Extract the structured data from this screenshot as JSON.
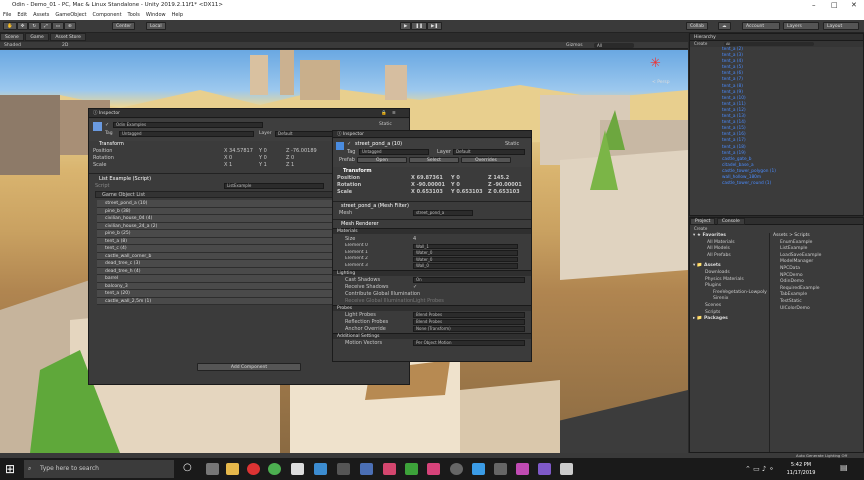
{
  "window": {
    "title": "Odin - Demo_01 - PC, Mac & Linux Standalone - Unity 2019.2.11f1* <DX11>",
    "min_icon": "minimize-icon",
    "max_icon": "maximize-icon",
    "close_icon": "close-icon"
  },
  "menu": [
    "File",
    "Edit",
    "Assets",
    "GameObject",
    "Component",
    "Tools",
    "Window",
    "Help"
  ],
  "toolbar": {
    "pivot": "Center",
    "space": "Local",
    "collab": "Collab",
    "account": "Account",
    "layers": "Layers",
    "layout": "Layout"
  },
  "scene": {
    "tabs": [
      "Scene",
      "Game",
      "Asset Store"
    ],
    "shading": "Shaded",
    "mode": "2D",
    "gizmos": "Gizmos",
    "search": "All",
    "persp": "< Persp"
  },
  "inspector1": {
    "title": "Inspector",
    "active": "✓",
    "name": "Odin Examples",
    "static": "Static",
    "tag_label": "Tag",
    "tag": "Untagged",
    "layer_label": "Layer",
    "layer": "Default",
    "transform": "Transform",
    "pos_label": "Position",
    "pos_x": "X  34.57817",
    "pos_y": "Y  0",
    "pos_z": "Z  -76.00189",
    "rot_label": "Rotation",
    "rot_x": "X  0",
    "rot_y": "Y  0",
    "rot_z": "Z  0",
    "scale_label": "Scale",
    "sc_x": "X  1",
    "sc_y": "Y  1",
    "sc_z": "Z  1",
    "component": "List Example (Script)",
    "script_label": "Script",
    "script": "ListExample",
    "list_label": "Game Object List",
    "items": [
      "street_pond_a (10)",
      "pine_b (38)",
      "civilian_house_04 (4)",
      "civilian_house_24_a (2)",
      "pine_b (25)",
      "tent_a (8)",
      "tent_c (4)",
      "castle_wall_corner_b",
      "dead_tree_c (3)",
      "dead_tree_h (4)",
      "barrel",
      "balcony_3",
      "tent_a (20)",
      "castle_wall_2,5m (1)"
    ],
    "add_component": "Add Component"
  },
  "inspector2": {
    "title": "Inspector",
    "active": "✓",
    "name": "street_pond_a (10)",
    "static": "Static",
    "tag_label": "Tag",
    "tag": "Untagged",
    "layer_label": "Layer",
    "layer": "Default",
    "prefab_label": "Prefab",
    "open": "Open",
    "select": "Select",
    "overrides": "Overrides",
    "transform": "Transform",
    "pos_label": "Position",
    "pos_x": "X  69.87361",
    "pos_y": "Y  0",
    "pos_z": "Z  145.2",
    "rot_label": "Rotation",
    "rot_x": "X  -90.00001",
    "rot_y": "Y  0",
    "rot_z": "Z  -90.00001",
    "scale_label": "Scale",
    "sc_x": "X  0.653103",
    "sc_y": "Y  0.653103",
    "sc_z": "Z  0.653103",
    "meshfilter": "street_pond_a (Mesh Filter)",
    "mesh_label": "Mesh",
    "mesh": "street_pond_a",
    "meshrenderer": "Mesh Renderer",
    "materials": "Materials",
    "size_label": "Size",
    "size": "4",
    "elements": [
      {
        "l": "Element 0",
        "v": "Wall_1"
      },
      {
        "l": "Element 1",
        "v": "Water_0"
      },
      {
        "l": "Element 2",
        "v": "Water_0"
      },
      {
        "l": "Element 3",
        "v": "Wall_0"
      }
    ],
    "lighting": "Lighting",
    "cast_label": "Cast Shadows",
    "cast": "On",
    "recv_label": "Receive Shadows",
    "recv": "✓",
    "gi_label": "Contribute Global Illumination",
    "gi2_label": "Receive Global Illumination",
    "gi2": "Light Probes",
    "probes": "Probes",
    "lp_label": "Light Probes",
    "lp": "Blend Probes",
    "rp_label": "Reflection Probes",
    "rp": "Blend Probes",
    "ao_label": "Anchor Override",
    "ao": "None (Transform)",
    "addl": "Additional Settings",
    "mv_label": "Motion Vectors",
    "mv": "Per Object Motion"
  },
  "hierarchy": {
    "title": "Hierarchy",
    "create": "Create",
    "search": "All",
    "items": [
      "tent_a (2)",
      "tent_a (3)",
      "tent_a (4)",
      "tent_a (5)",
      "tent_a (6)",
      "tent_a (7)",
      "tent_a (8)",
      "tent_a (9)",
      "tent_a (10)",
      "tent_a (11)",
      "tent_a (12)",
      "tent_a (13)",
      "tent_a (14)",
      "tent_a (15)",
      "tent_a (16)",
      "tent_a (17)",
      "tent_a (18)",
      "tent_a (19)",
      "castle_gate_b",
      "citadel_base_a",
      "castle_tower_polygon (1)",
      "wall_hollow_180m",
      "castle_tower_round (1)"
    ]
  },
  "project": {
    "tabs": [
      "Project",
      "Console"
    ],
    "create": "Create",
    "favorites": "Favorites",
    "fav_items": [
      "All Materials",
      "All Models",
      "All Prefabs"
    ],
    "assets": "Assets",
    "asset_items": [
      "Downloads",
      "Physics Materials",
      "Plugins",
      "FreeVegetation-Lowpoly",
      "Sirenix",
      "Scenes",
      "Scripts"
    ],
    "packages": "Packages",
    "breadcrumb": "Assets > Scripts",
    "files": [
      "EnumExample",
      "ListExample",
      "LoadSaveExample",
      "ModelManager",
      "NPCData",
      "NPCDemo",
      "OdinDemo",
      "RequiredExample",
      "TabExample",
      "TestStatic",
      "UIColorDemo"
    ]
  },
  "status": "Auto Generate Lighting Off",
  "taskbar": {
    "search": "Type here to search",
    "time": "5:42 PM",
    "date": "11/17/2019"
  }
}
